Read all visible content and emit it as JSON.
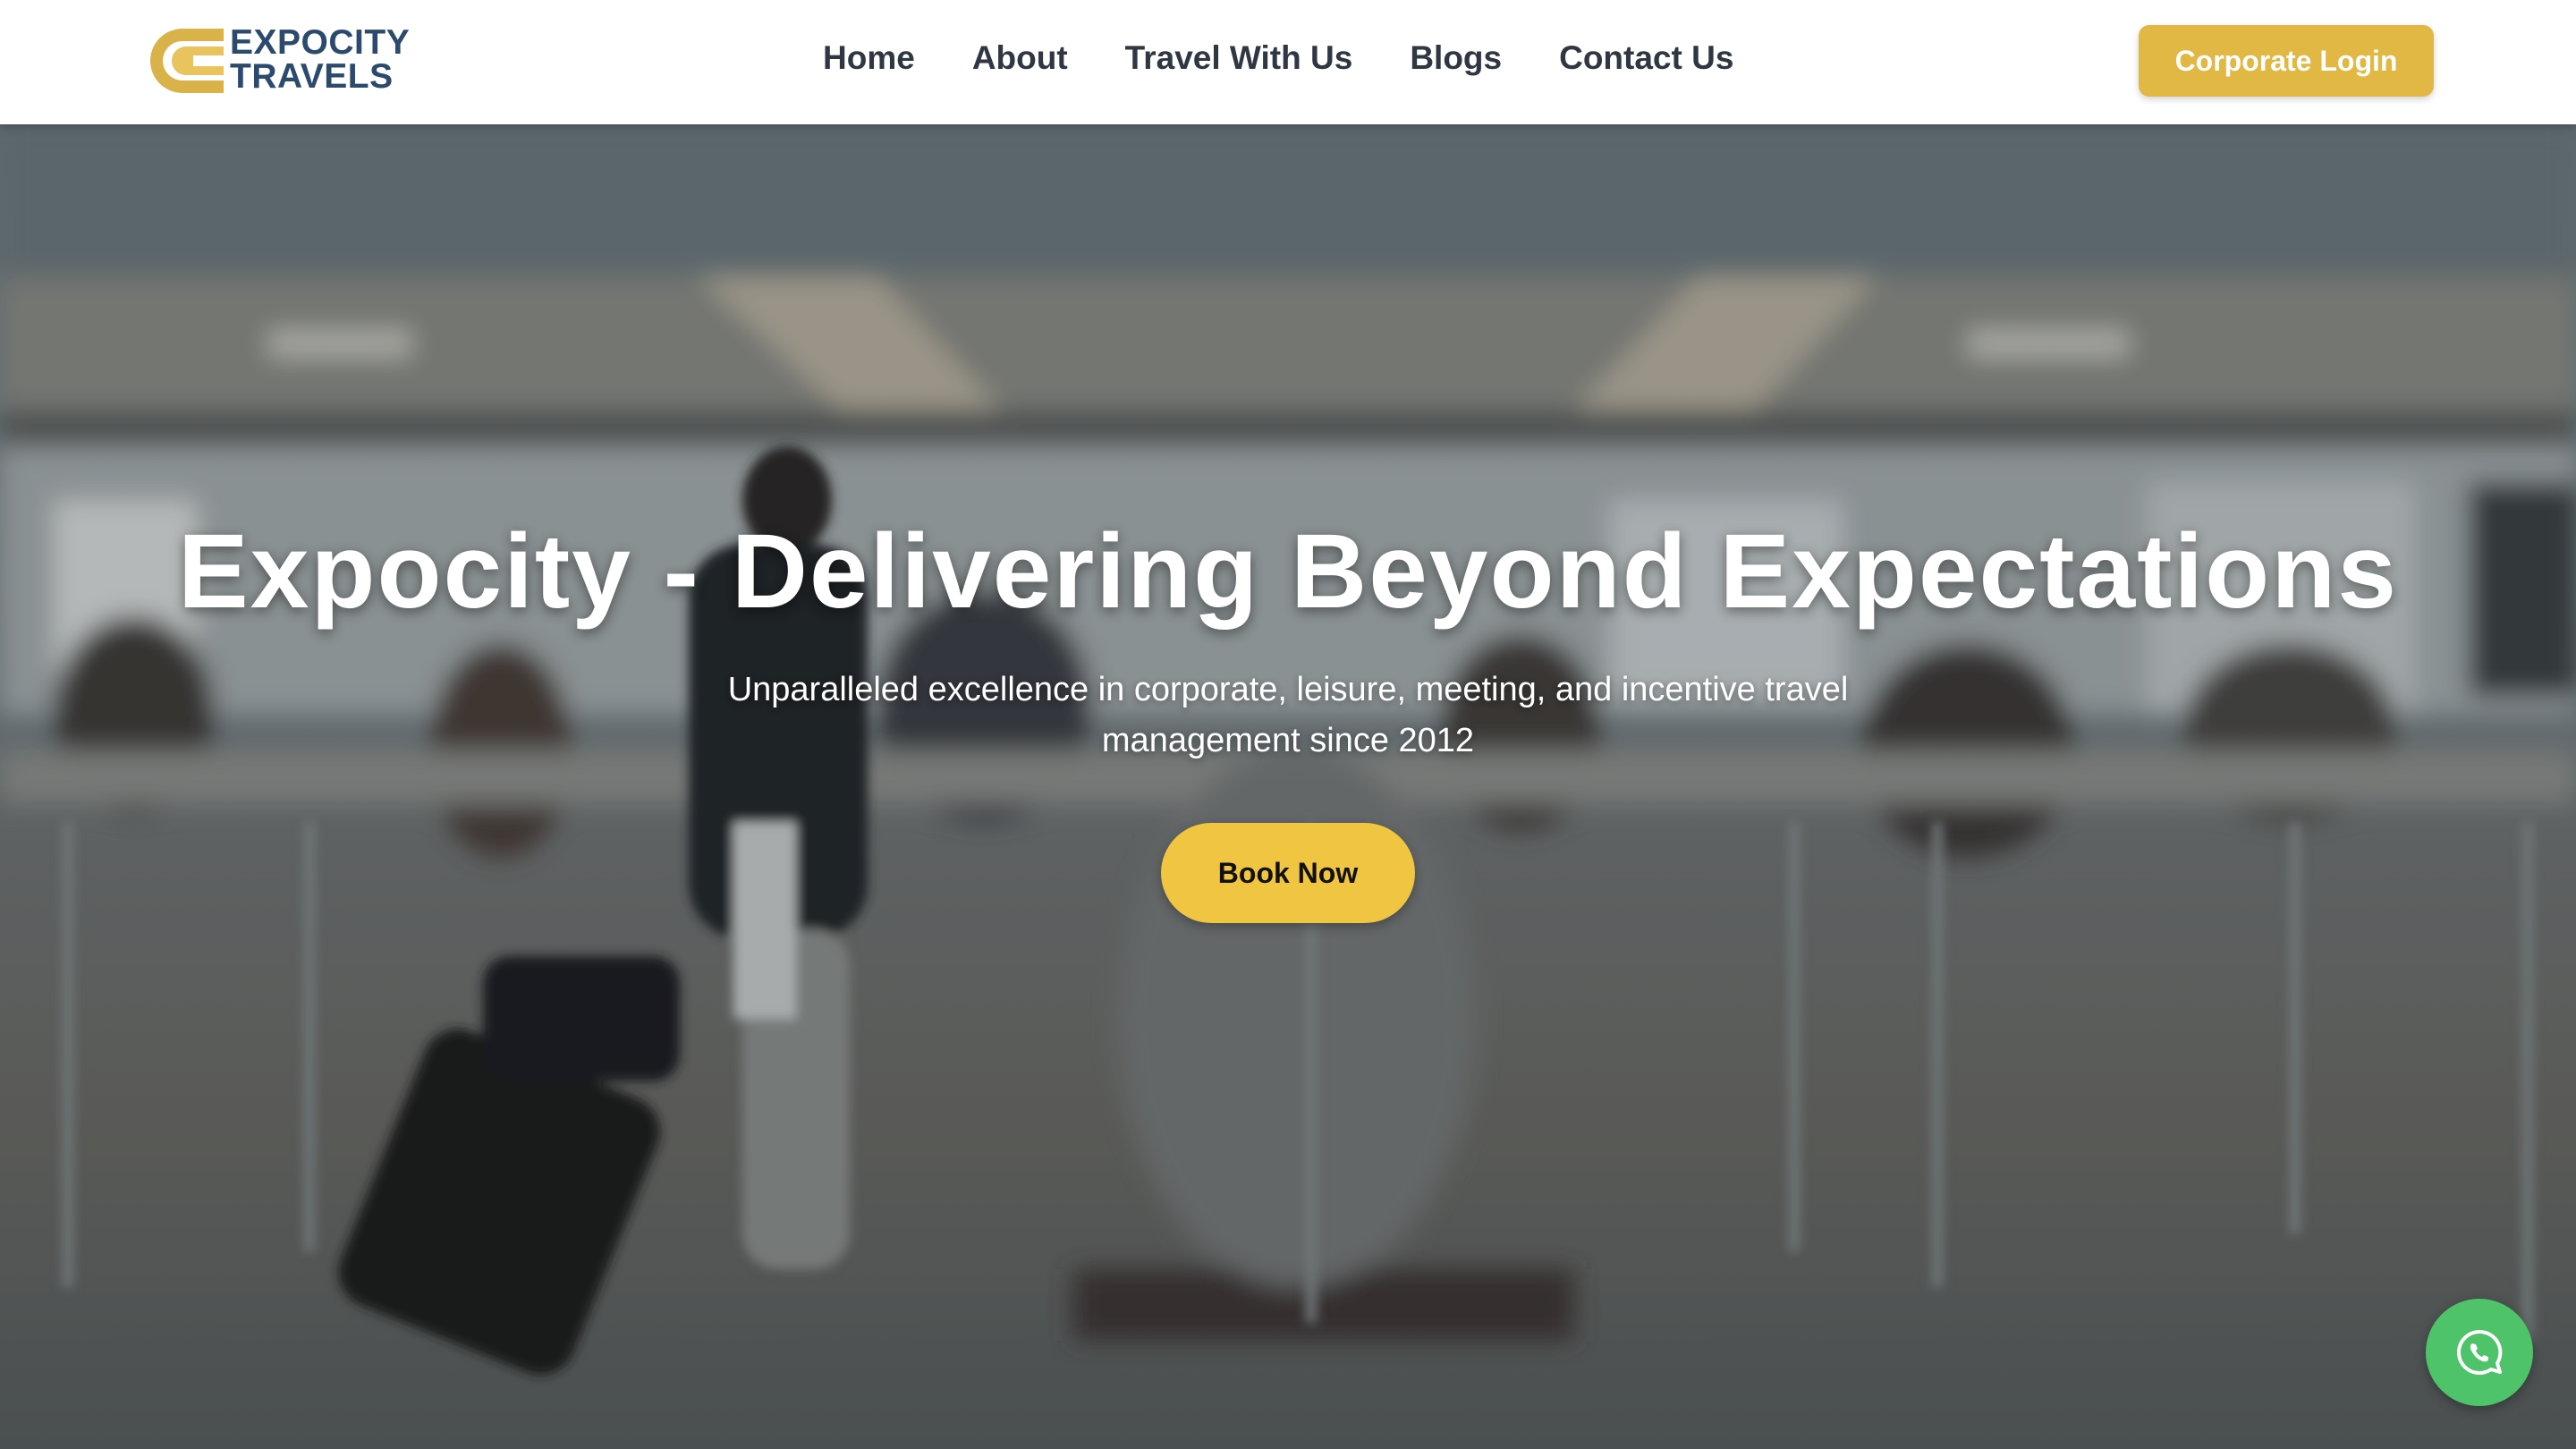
{
  "brand": {
    "name_line1": "EXPOCITY",
    "name_line2": "TRAVELS",
    "color_primary": "#2c4a6e",
    "color_accent": "#e2b844"
  },
  "nav": {
    "items": [
      {
        "label": "Home"
      },
      {
        "label": "About"
      },
      {
        "label": "Travel With Us"
      },
      {
        "label": "Blogs"
      },
      {
        "label": "Contact Us"
      }
    ]
  },
  "header": {
    "corporate_login_label": "Corporate Login"
  },
  "hero": {
    "title": "Expocity - Delivering Beyond Expectations",
    "subtitle": "Unparalleled excellence in corporate, leisure, meeting, and incentive travel management since 2012",
    "cta_label": "Book Now",
    "background_description_icon": "airport-terminal-photo"
  },
  "floating": {
    "whatsapp_icon": "whatsapp-icon",
    "whatsapp_color": "#4ec36a"
  }
}
